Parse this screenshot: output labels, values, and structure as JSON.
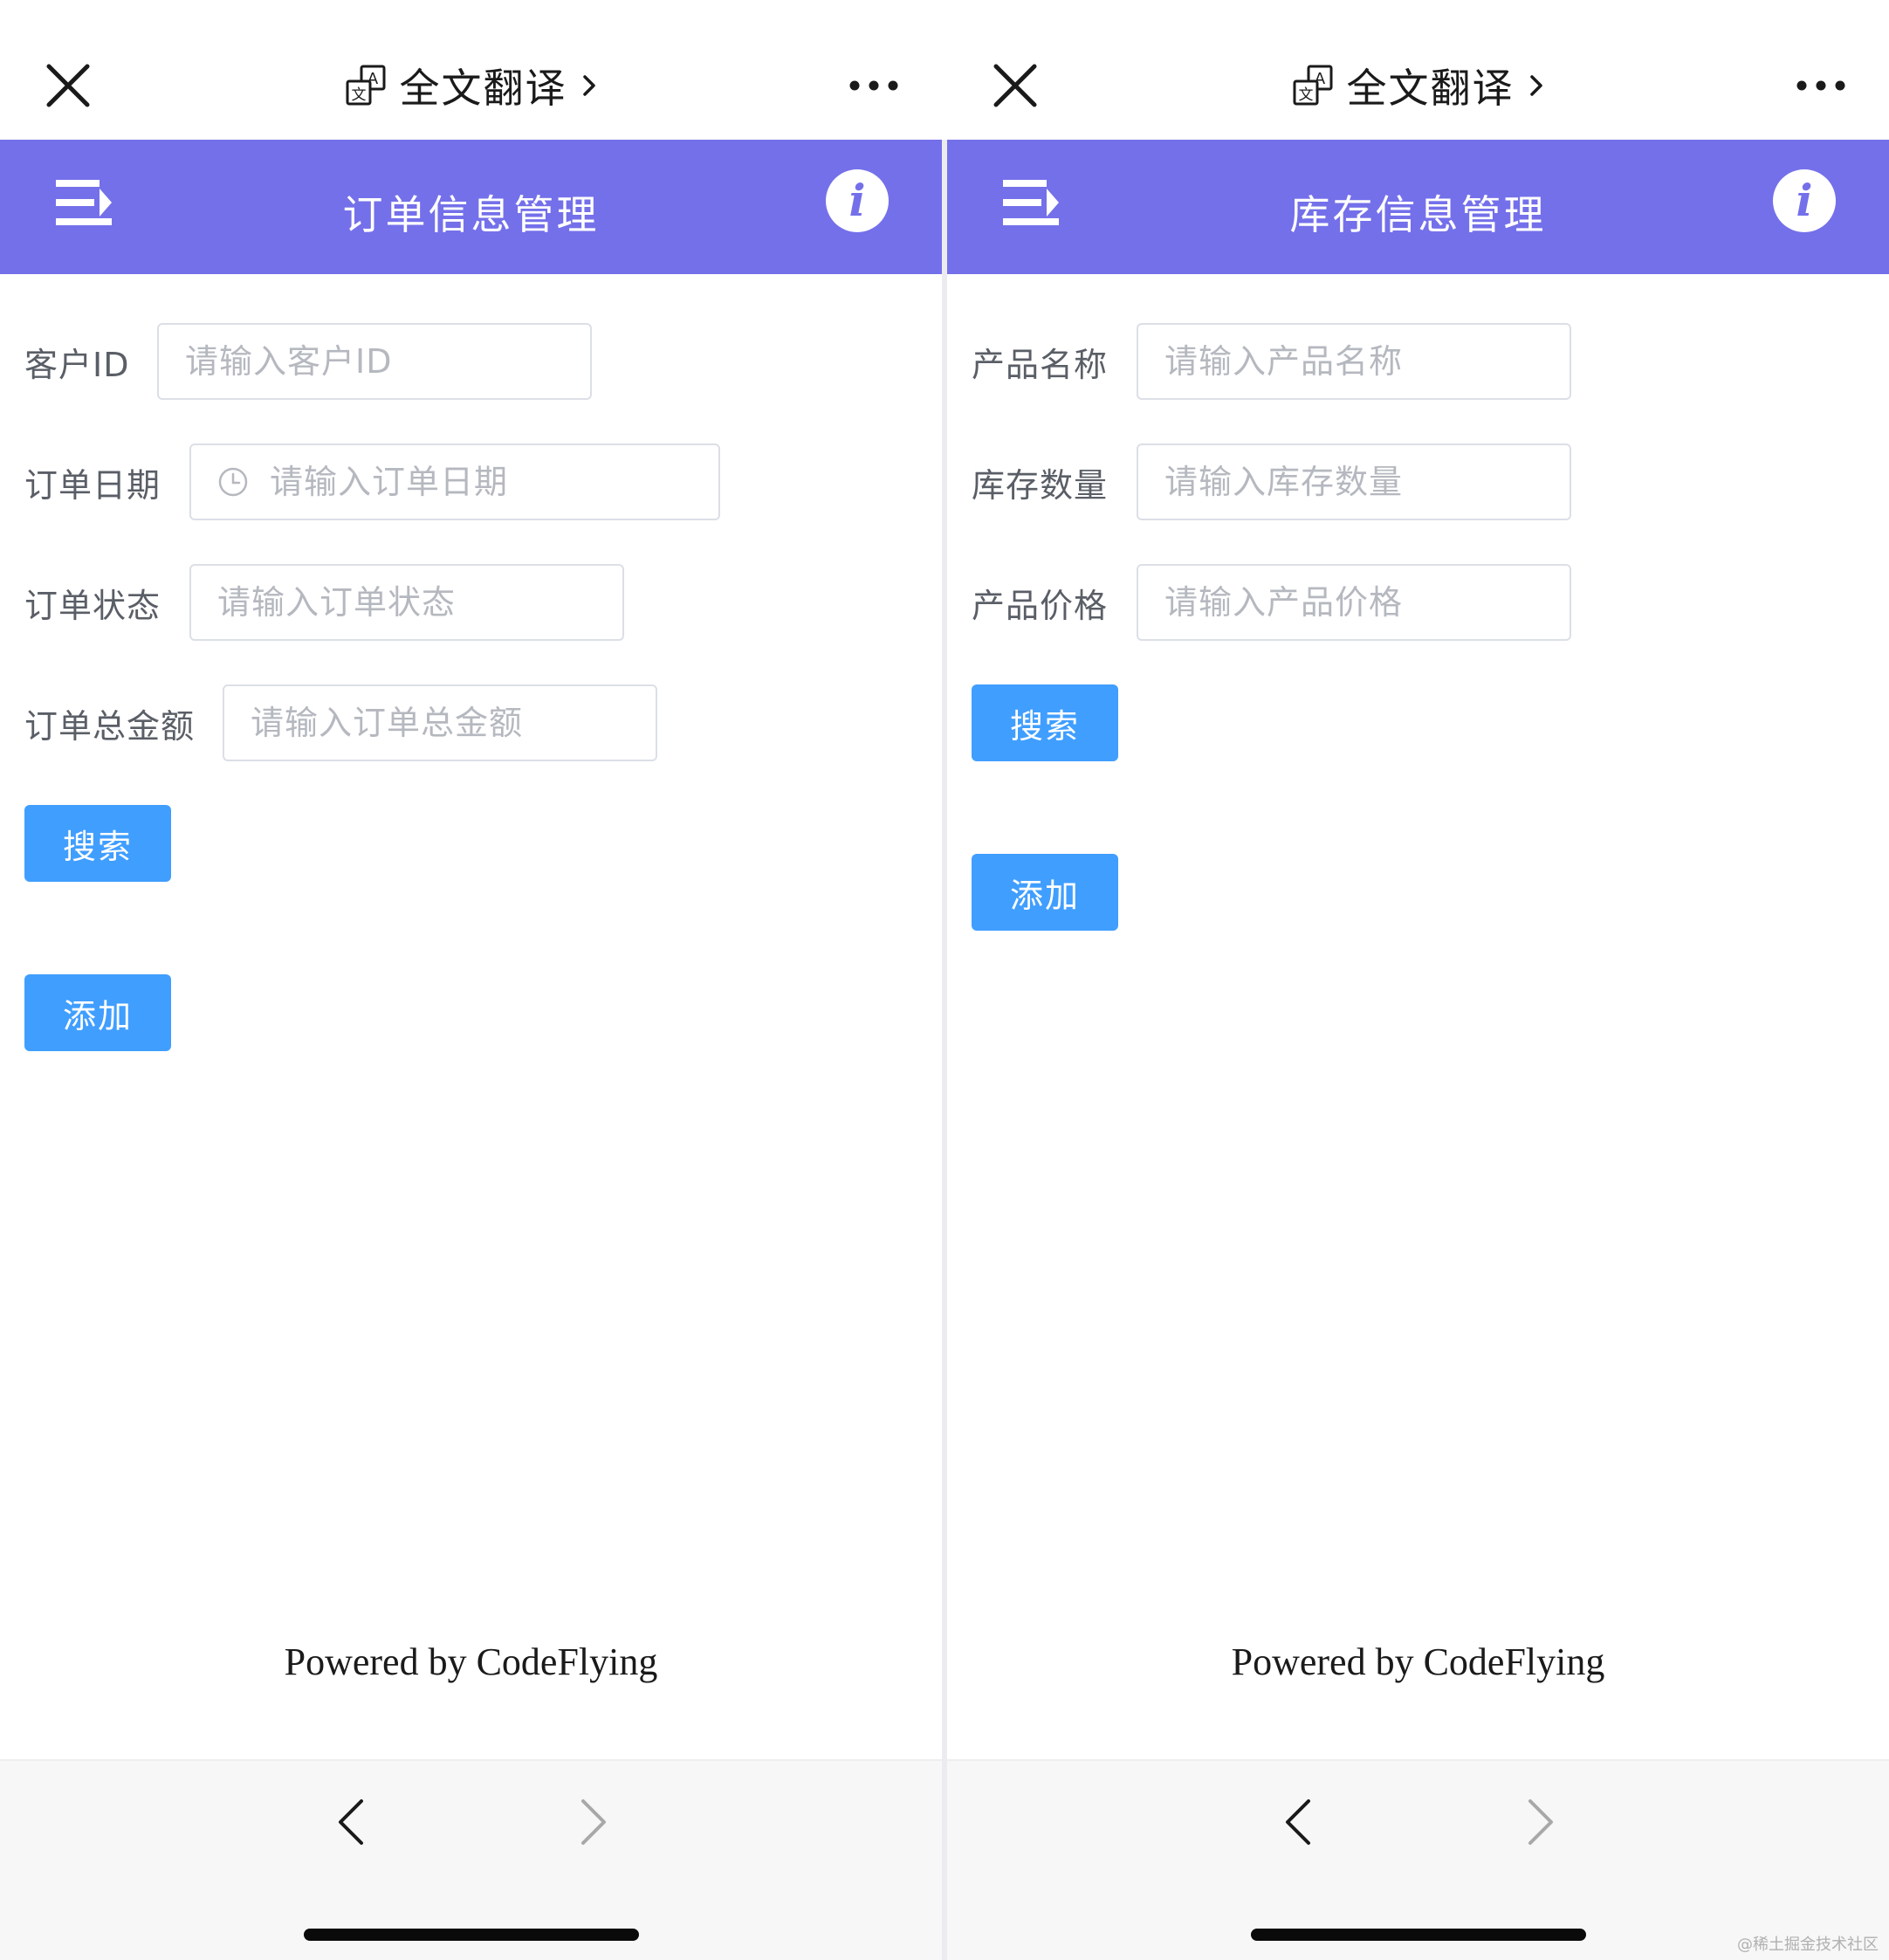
{
  "browser": {
    "translate_label": "全文翻译",
    "translate_icon": "translate-icon",
    "close_icon": "close-icon",
    "more_icon": "more-dots-icon"
  },
  "theme": {
    "header_color": "#7470ea",
    "button_color": "#409eff"
  },
  "orders": {
    "title": "订单信息管理",
    "fields": [
      {
        "label": "客户ID",
        "placeholder": "请输入客户ID"
      },
      {
        "label": "订单日期",
        "placeholder": "请输入订单日期"
      },
      {
        "label": "订单状态",
        "placeholder": "请输入订单状态"
      },
      {
        "label": "订单总金额",
        "placeholder": "请输入订单总金额"
      }
    ],
    "search_label": "搜索",
    "add_label": "添加",
    "footer": "Powered by CodeFlying"
  },
  "inventory": {
    "title": "库存信息管理",
    "fields": [
      {
        "label": "产品名称",
        "placeholder": "请输入产品名称"
      },
      {
        "label": "库存数量",
        "placeholder": "请输入库存数量"
      },
      {
        "label": "产品价格",
        "placeholder": "请输入产品价格"
      }
    ],
    "search_label": "搜索",
    "add_label": "添加",
    "footer": "Powered by CodeFlying"
  },
  "watermark": "@稀土掘金技术社区"
}
